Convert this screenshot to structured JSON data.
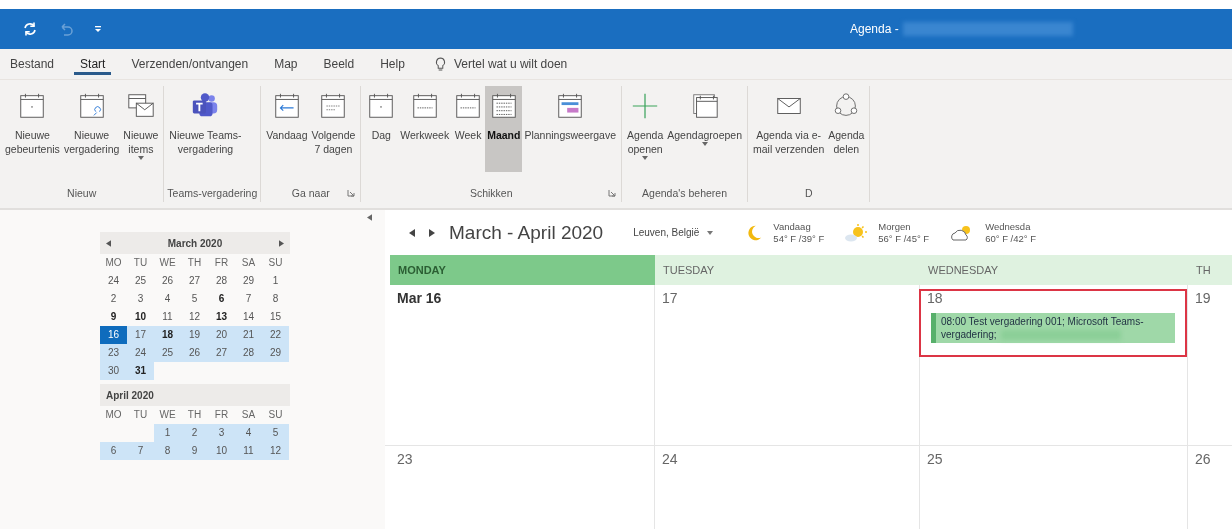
{
  "window": {
    "title": "Agenda -"
  },
  "quick_access": [
    {
      "kind": "sync",
      "disabled": false
    },
    {
      "kind": "undo",
      "disabled": true
    },
    {
      "kind": "customize",
      "disabled": false
    }
  ],
  "tabs": [
    {
      "label": "Bestand",
      "selected": false
    },
    {
      "label": "Start",
      "selected": true
    },
    {
      "label": "Verzenden/ontvangen",
      "selected": false
    },
    {
      "label": "Map",
      "selected": false
    },
    {
      "label": "Beeld",
      "selected": false
    },
    {
      "label": "Help",
      "selected": false
    }
  ],
  "tell_me": {
    "placeholder": "Vertel wat u wilt doen"
  },
  "ribbon": [
    {
      "label": "Nieuw",
      "launcher": false,
      "buttons": [
        {
          "kind": "event",
          "lines": [
            "Nieuwe",
            "gebeurtenis"
          ],
          "caret": false,
          "selected": false
        },
        {
          "kind": "meeting",
          "lines": [
            "Nieuwe",
            "vergadering"
          ],
          "caret": false,
          "selected": false
        },
        {
          "kind": "items",
          "lines": [
            "Nieuwe",
            "items"
          ],
          "caret": true,
          "selected": false
        }
      ]
    },
    {
      "label": "Teams-vergadering",
      "launcher": false,
      "buttons": [
        {
          "kind": "teams",
          "lines": [
            "Nieuwe Teams-",
            "vergadering"
          ],
          "caret": false,
          "selected": false
        }
      ]
    },
    {
      "label": "Ga naar",
      "launcher": true,
      "buttons": [
        {
          "kind": "today",
          "lines": [
            "Vandaag"
          ],
          "caret": false,
          "selected": false
        },
        {
          "kind": "next7",
          "lines": [
            "Volgende",
            "7 dagen"
          ],
          "caret": false,
          "selected": false
        }
      ]
    },
    {
      "label": "Schikken",
      "launcher": true,
      "buttons": [
        {
          "kind": "day",
          "lines": [
            "Dag"
          ],
          "caret": false,
          "selected": false
        },
        {
          "kind": "workweek",
          "lines": [
            "Werkweek"
          ],
          "caret": false,
          "selected": false
        },
        {
          "kind": "week",
          "lines": [
            "Week"
          ],
          "caret": false,
          "selected": false
        },
        {
          "kind": "month",
          "lines": [
            "Maand"
          ],
          "caret": false,
          "selected": true
        },
        {
          "kind": "schedule",
          "lines": [
            "Planningsweergave"
          ],
          "caret": false,
          "selected": false
        }
      ]
    },
    {
      "label": "Agenda's beheren",
      "launcher": false,
      "buttons": [
        {
          "kind": "add",
          "lines": [
            "Agenda",
            "openen"
          ],
          "caret": true,
          "selected": false
        },
        {
          "kind": "groups",
          "lines": [
            "Agendagroepen"
          ],
          "caret": true,
          "selected": false
        }
      ]
    },
    {
      "label": "D",
      "launcher": false,
      "buttons": [
        {
          "kind": "email",
          "lines": [
            "Agenda via e-",
            "mail verzenden"
          ],
          "caret": false,
          "selected": false
        },
        {
          "kind": "share",
          "lines": [
            "Agenda",
            "delen"
          ],
          "caret": false,
          "selected": false
        }
      ]
    }
  ],
  "mini_calendars": [
    {
      "title": "March 2020",
      "nav": true,
      "weekdays": [
        "MO",
        "TU",
        "WE",
        "TH",
        "FR",
        "SA",
        "SU"
      ],
      "weeks": [
        [
          {
            "day": "24",
            "bold": false,
            "in_range": false,
            "selected": false
          },
          {
            "day": "25",
            "bold": false,
            "in_range": false,
            "selected": false
          },
          {
            "day": "26",
            "bold": false,
            "in_range": false,
            "selected": false
          },
          {
            "day": "27",
            "bold": false,
            "in_range": false,
            "selected": false
          },
          {
            "day": "28",
            "bold": false,
            "in_range": false,
            "selected": false
          },
          {
            "day": "29",
            "bold": false,
            "in_range": false,
            "selected": false
          },
          {
            "day": "1",
            "bold": false,
            "in_range": false,
            "selected": false
          }
        ],
        [
          {
            "day": "2",
            "bold": false,
            "in_range": false,
            "selected": false
          },
          {
            "day": "3",
            "bold": false,
            "in_range": false,
            "selected": false
          },
          {
            "day": "4",
            "bold": false,
            "in_range": false,
            "selected": false
          },
          {
            "day": "5",
            "bold": false,
            "in_range": false,
            "selected": false
          },
          {
            "day": "6",
            "bold": true,
            "in_range": false,
            "selected": false
          },
          {
            "day": "7",
            "bold": false,
            "in_range": false,
            "selected": false
          },
          {
            "day": "8",
            "bold": false,
            "in_range": false,
            "selected": false
          }
        ],
        [
          {
            "day": "9",
            "bold": true,
            "in_range": false,
            "selected": false
          },
          {
            "day": "10",
            "bold": true,
            "in_range": false,
            "selected": false
          },
          {
            "day": "11",
            "bold": false,
            "in_range": false,
            "selected": false
          },
          {
            "day": "12",
            "bold": false,
            "in_range": false,
            "selected": false
          },
          {
            "day": "13",
            "bold": true,
            "in_range": false,
            "selected": false
          },
          {
            "day": "14",
            "bold": false,
            "in_range": false,
            "selected": false
          },
          {
            "day": "15",
            "bold": false,
            "in_range": false,
            "selected": false
          }
        ],
        [
          {
            "day": "16",
            "bold": false,
            "in_range": true,
            "selected": true
          },
          {
            "day": "17",
            "bold": false,
            "in_range": true,
            "selected": false
          },
          {
            "day": "18",
            "bold": true,
            "in_range": true,
            "selected": false
          },
          {
            "day": "19",
            "bold": false,
            "in_range": true,
            "selected": false
          },
          {
            "day": "20",
            "bold": false,
            "in_range": true,
            "selected": false
          },
          {
            "day": "21",
            "bold": false,
            "in_range": true,
            "selected": false
          },
          {
            "day": "22",
            "bold": false,
            "in_range": true,
            "selected": false
          }
        ],
        [
          {
            "day": "23",
            "bold": false,
            "in_range": true,
            "selected": false
          },
          {
            "day": "24",
            "bold": false,
            "in_range": true,
            "selected": false
          },
          {
            "day": "25",
            "bold": false,
            "in_range": true,
            "selected": false
          },
          {
            "day": "26",
            "bold": false,
            "in_range": true,
            "selected": false
          },
          {
            "day": "27",
            "bold": false,
            "in_range": true,
            "selected": false
          },
          {
            "day": "28",
            "bold": false,
            "in_range": true,
            "selected": false
          },
          {
            "day": "29",
            "bold": false,
            "in_range": true,
            "selected": false
          }
        ],
        [
          {
            "day": "30",
            "bold": false,
            "in_range": true,
            "selected": false
          },
          {
            "day": "31",
            "bold": true,
            "in_range": true,
            "selected": false
          }
        ]
      ]
    },
    {
      "title": "April 2020",
      "nav": false,
      "weekdays": [
        "MO",
        "TU",
        "WE",
        "TH",
        "FR",
        "SA",
        "SU"
      ],
      "weeks": [
        [
          {
            "day": "1",
            "bold": false,
            "in_range": true,
            "selected": false
          },
          {
            "day": "2",
            "bold": false,
            "in_range": true,
            "selected": false
          },
          {
            "day": "3",
            "bold": false,
            "in_range": true,
            "selected": false
          },
          {
            "day": "4",
            "bold": false,
            "in_range": true,
            "selected": false
          },
          {
            "day": "5",
            "bold": false,
            "in_range": true,
            "selected": false
          }
        ],
        [
          {
            "day": "6",
            "bold": false,
            "in_range": true,
            "selected": false
          },
          {
            "day": "7",
            "bold": false,
            "in_range": true,
            "selected": false
          },
          {
            "day": "8",
            "bold": false,
            "in_range": true,
            "selected": false
          },
          {
            "day": "9",
            "bold": false,
            "in_range": true,
            "selected": false
          },
          {
            "day": "10",
            "bold": false,
            "in_range": true,
            "selected": false
          },
          {
            "day": "11",
            "bold": false,
            "in_range": true,
            "selected": false
          },
          {
            "day": "12",
            "bold": false,
            "in_range": true,
            "selected": false
          }
        ]
      ]
    }
  ],
  "calendar": {
    "range_title": "March - April 2020",
    "location": "Leuven, België",
    "weather": [
      {
        "kind": "moon",
        "label": "Vandaag",
        "temps": "54° F /39° F"
      },
      {
        "kind": "sun",
        "label": "Morgen",
        "temps": "56° F /45° F"
      },
      {
        "kind": "cloud",
        "label": "Wednesda",
        "temps": "60° F /42° F"
      }
    ],
    "columns": [
      {
        "label": "MONDAY",
        "selected": true
      },
      {
        "label": "TUESDAY",
        "selected": false
      },
      {
        "label": "WEDNESDAY",
        "selected": false
      },
      {
        "label": "TH",
        "selected": false
      }
    ],
    "weeks": [
      [
        {
          "date": "Mar 16",
          "today": true
        },
        {
          "date": "17",
          "today": false
        },
        {
          "date": "18",
          "today": false,
          "events": [
            {
              "text": "08:00 Test vergadering 001; Microsoft Teams-vergadering;",
              "highlighted": true,
              "color": "#9fd8a8"
            }
          ]
        },
        {
          "date": "19",
          "today": false
        }
      ],
      [
        {
          "date": "23",
          "today": false
        },
        {
          "date": "24",
          "today": false
        },
        {
          "date": "25",
          "today": false
        },
        {
          "date": "26",
          "today": false
        }
      ]
    ]
  }
}
